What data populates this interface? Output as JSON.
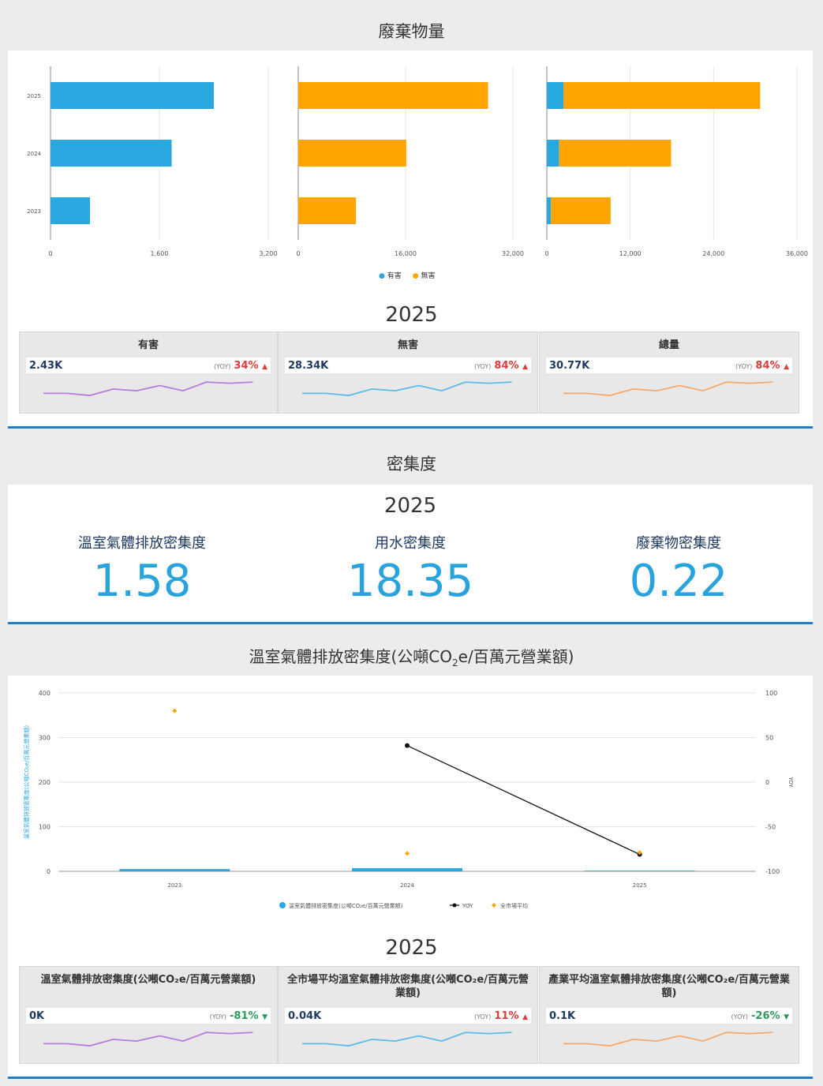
{
  "waste": {
    "title": "廢棄物量",
    "years": [
      "2025",
      "2024",
      "2023"
    ],
    "hazardous": [
      2400,
      1780,
      580
    ],
    "non_hazardous": [
      28300,
      16100,
      8600
    ],
    "charts": [
      {
        "ticks": [
          "0",
          "1,600",
          "3,200"
        ],
        "max": 3200
      },
      {
        "ticks": [
          "0",
          "16,000",
          "32,000"
        ],
        "max": 32000
      },
      {
        "ticks": [
          "0",
          "12,000",
          "24,000",
          "36,000"
        ],
        "max": 36000
      }
    ],
    "legend": {
      "hazardous": "有害",
      "non_hazardous": "無害"
    },
    "colors": {
      "hazardous": "#29a8e0",
      "non_hazardous": "#ffa500"
    },
    "kpi_year": "2025",
    "kpis": [
      {
        "title": "有害",
        "value": "2.43K",
        "yoy_label": "(YOY)",
        "yoy": "34%",
        "dir": "up",
        "arrow": "▲",
        "color": "#b57be0"
      },
      {
        "title": "無害",
        "value": "28.34K",
        "yoy_label": "(YOY)",
        "yoy": "84%",
        "dir": "up",
        "arrow": "▲",
        "color": "#5bbbe6"
      },
      {
        "title": "總量",
        "value": "30.77K",
        "yoy_label": "(YOY)",
        "yoy": "84%",
        "dir": "up",
        "arrow": "▲",
        "color": "#f5a86b"
      }
    ]
  },
  "intensity": {
    "title": "密集度",
    "year": "2025",
    "metrics": [
      {
        "label": "溫室氣體排放密集度",
        "value": "1.58"
      },
      {
        "label": "用水密集度",
        "value": "18.35"
      },
      {
        "label": "廢棄物密集度",
        "value": "0.22"
      }
    ]
  },
  "ghg": {
    "title_pre": "溫室氣體排放密集度(公噸CO",
    "title_sub": "2",
    "title_post": "e/百萬元營業額)",
    "chart_data": {
      "type": "bar",
      "categories": [
        "2023",
        "2024",
        "2025"
      ],
      "series": [
        {
          "name": "溫室氣體排放密集度(公噸CO₂e/百萬元營業額)",
          "values": [
            5,
            7,
            1.58
          ],
          "color": "#29a8e0"
        },
        {
          "name": "YOY",
          "values": [
            null,
            41,
            -81
          ],
          "color": "#111111"
        },
        {
          "name": "全市場平均",
          "values": [
            360,
            40,
            42
          ],
          "color": "#ffa500"
        }
      ],
      "ylim": [
        0,
        400
      ],
      "y2lim": [
        -100,
        100
      ],
      "yticks": [
        "0",
        "100",
        "200",
        "300",
        "400"
      ],
      "y2ticks": [
        "-100",
        "-50",
        "0",
        "50",
        "100"
      ],
      "ylabel": "溫室氣體排放密集度(公噸CO₂e/百萬元營業額)",
      "y2label": "YOY"
    },
    "kpi_year": "2025",
    "kpis": [
      {
        "title": "溫室氣體排放密集度(公噸CO₂e/百萬元營業額)",
        "value": "0K",
        "yoy_label": "(YOY)",
        "yoy": "-81%",
        "dir": "down",
        "arrow": "▼",
        "color": "#b57be0"
      },
      {
        "title": "全市場平均溫室氣體排放密集度(公噸CO₂e/百萬元營業額)",
        "value": "0.04K",
        "yoy_label": "(YOY)",
        "yoy": "11%",
        "dir": "up",
        "arrow": "▲",
        "color": "#5bbbe6"
      },
      {
        "title": "產業平均溫室氣體排放密集度(公噸CO₂e/百萬元營業額)",
        "value": "0.1K",
        "yoy_label": "(YOY)",
        "yoy": "-26%",
        "dir": "down",
        "arrow": "▼",
        "color": "#f5a86b"
      }
    ]
  }
}
